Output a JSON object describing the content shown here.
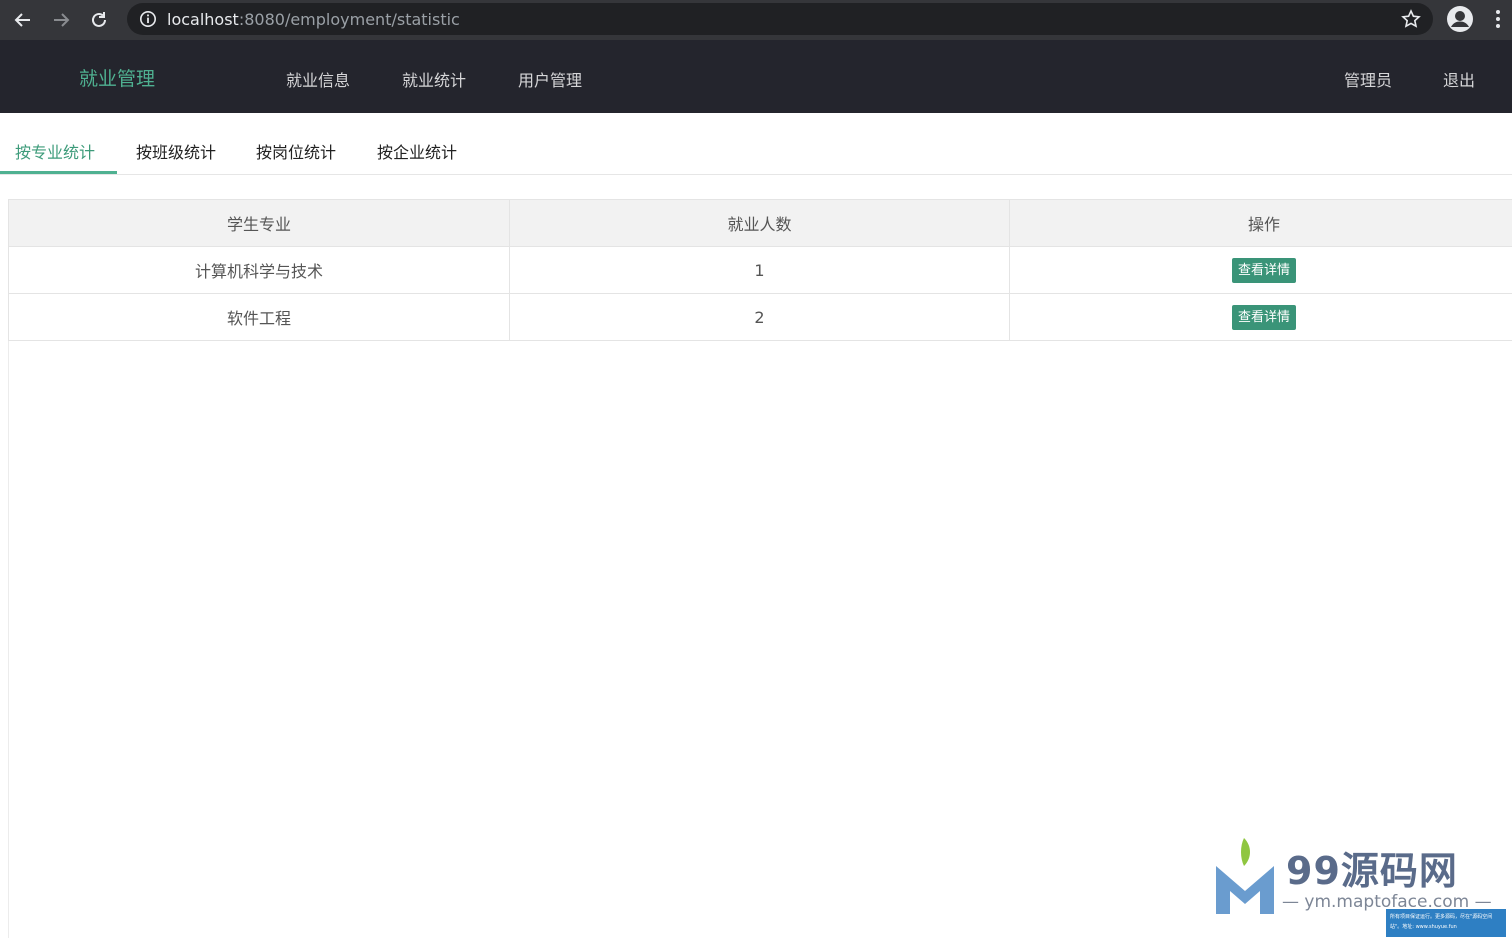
{
  "browser": {
    "url_host": "localhost",
    "url_rest": ":8080/employment/statistic"
  },
  "header": {
    "brand": "就业管理",
    "nav": [
      "就业信息",
      "就业统计",
      "用户管理"
    ],
    "user": "管理员",
    "logout": "退出"
  },
  "tabs": {
    "items": [
      "按专业统计",
      "按班级统计",
      "按岗位统计",
      "按企业统计"
    ],
    "active": 0
  },
  "table": {
    "headers": [
      "学生专业",
      "就业人数",
      "操作"
    ],
    "rows": [
      {
        "major": "计算机科学与技术",
        "count": "1",
        "action": "查看详情"
      },
      {
        "major": "软件工程",
        "count": "2",
        "action": "查看详情"
      }
    ]
  },
  "watermark": {
    "title": "99源码网",
    "subtitle": "— ym.maptoface.com —",
    "note": "所有项目保证运行。更多源码，尽在\"源码空间站\"。地址: www.shuyue.fun"
  },
  "colors": {
    "accent": "#4fb191",
    "header_bg": "#24252d",
    "button_bg": "#3a9478"
  }
}
